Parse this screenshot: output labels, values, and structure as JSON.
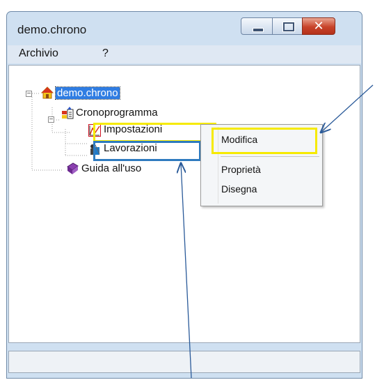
{
  "window": {
    "title": "demo.chrono"
  },
  "title_controls": {
    "minimize": "minimize",
    "maximize": "maximize",
    "close": "close"
  },
  "menubar": {
    "items": [
      "Archivio",
      "?"
    ]
  },
  "tree": {
    "root": "demo.chrono",
    "child": "Cronoprogramma",
    "grandchildren": [
      "Impostazioni",
      "Lavorazioni"
    ],
    "sibling": "Guida all'uso"
  },
  "context_menu": {
    "items": [
      "Modifica",
      "Proprietà",
      "Disegna"
    ]
  },
  "icons": [
    "home-icon",
    "schedule-icon",
    "chart-icon",
    "workers-icon",
    "book-icon"
  ],
  "colors": {
    "selection": "#2f7de3",
    "highlight_yellow": "#f6ea00",
    "highlight_blue": "#2f7bbf",
    "arrow": "#2a5a99"
  }
}
